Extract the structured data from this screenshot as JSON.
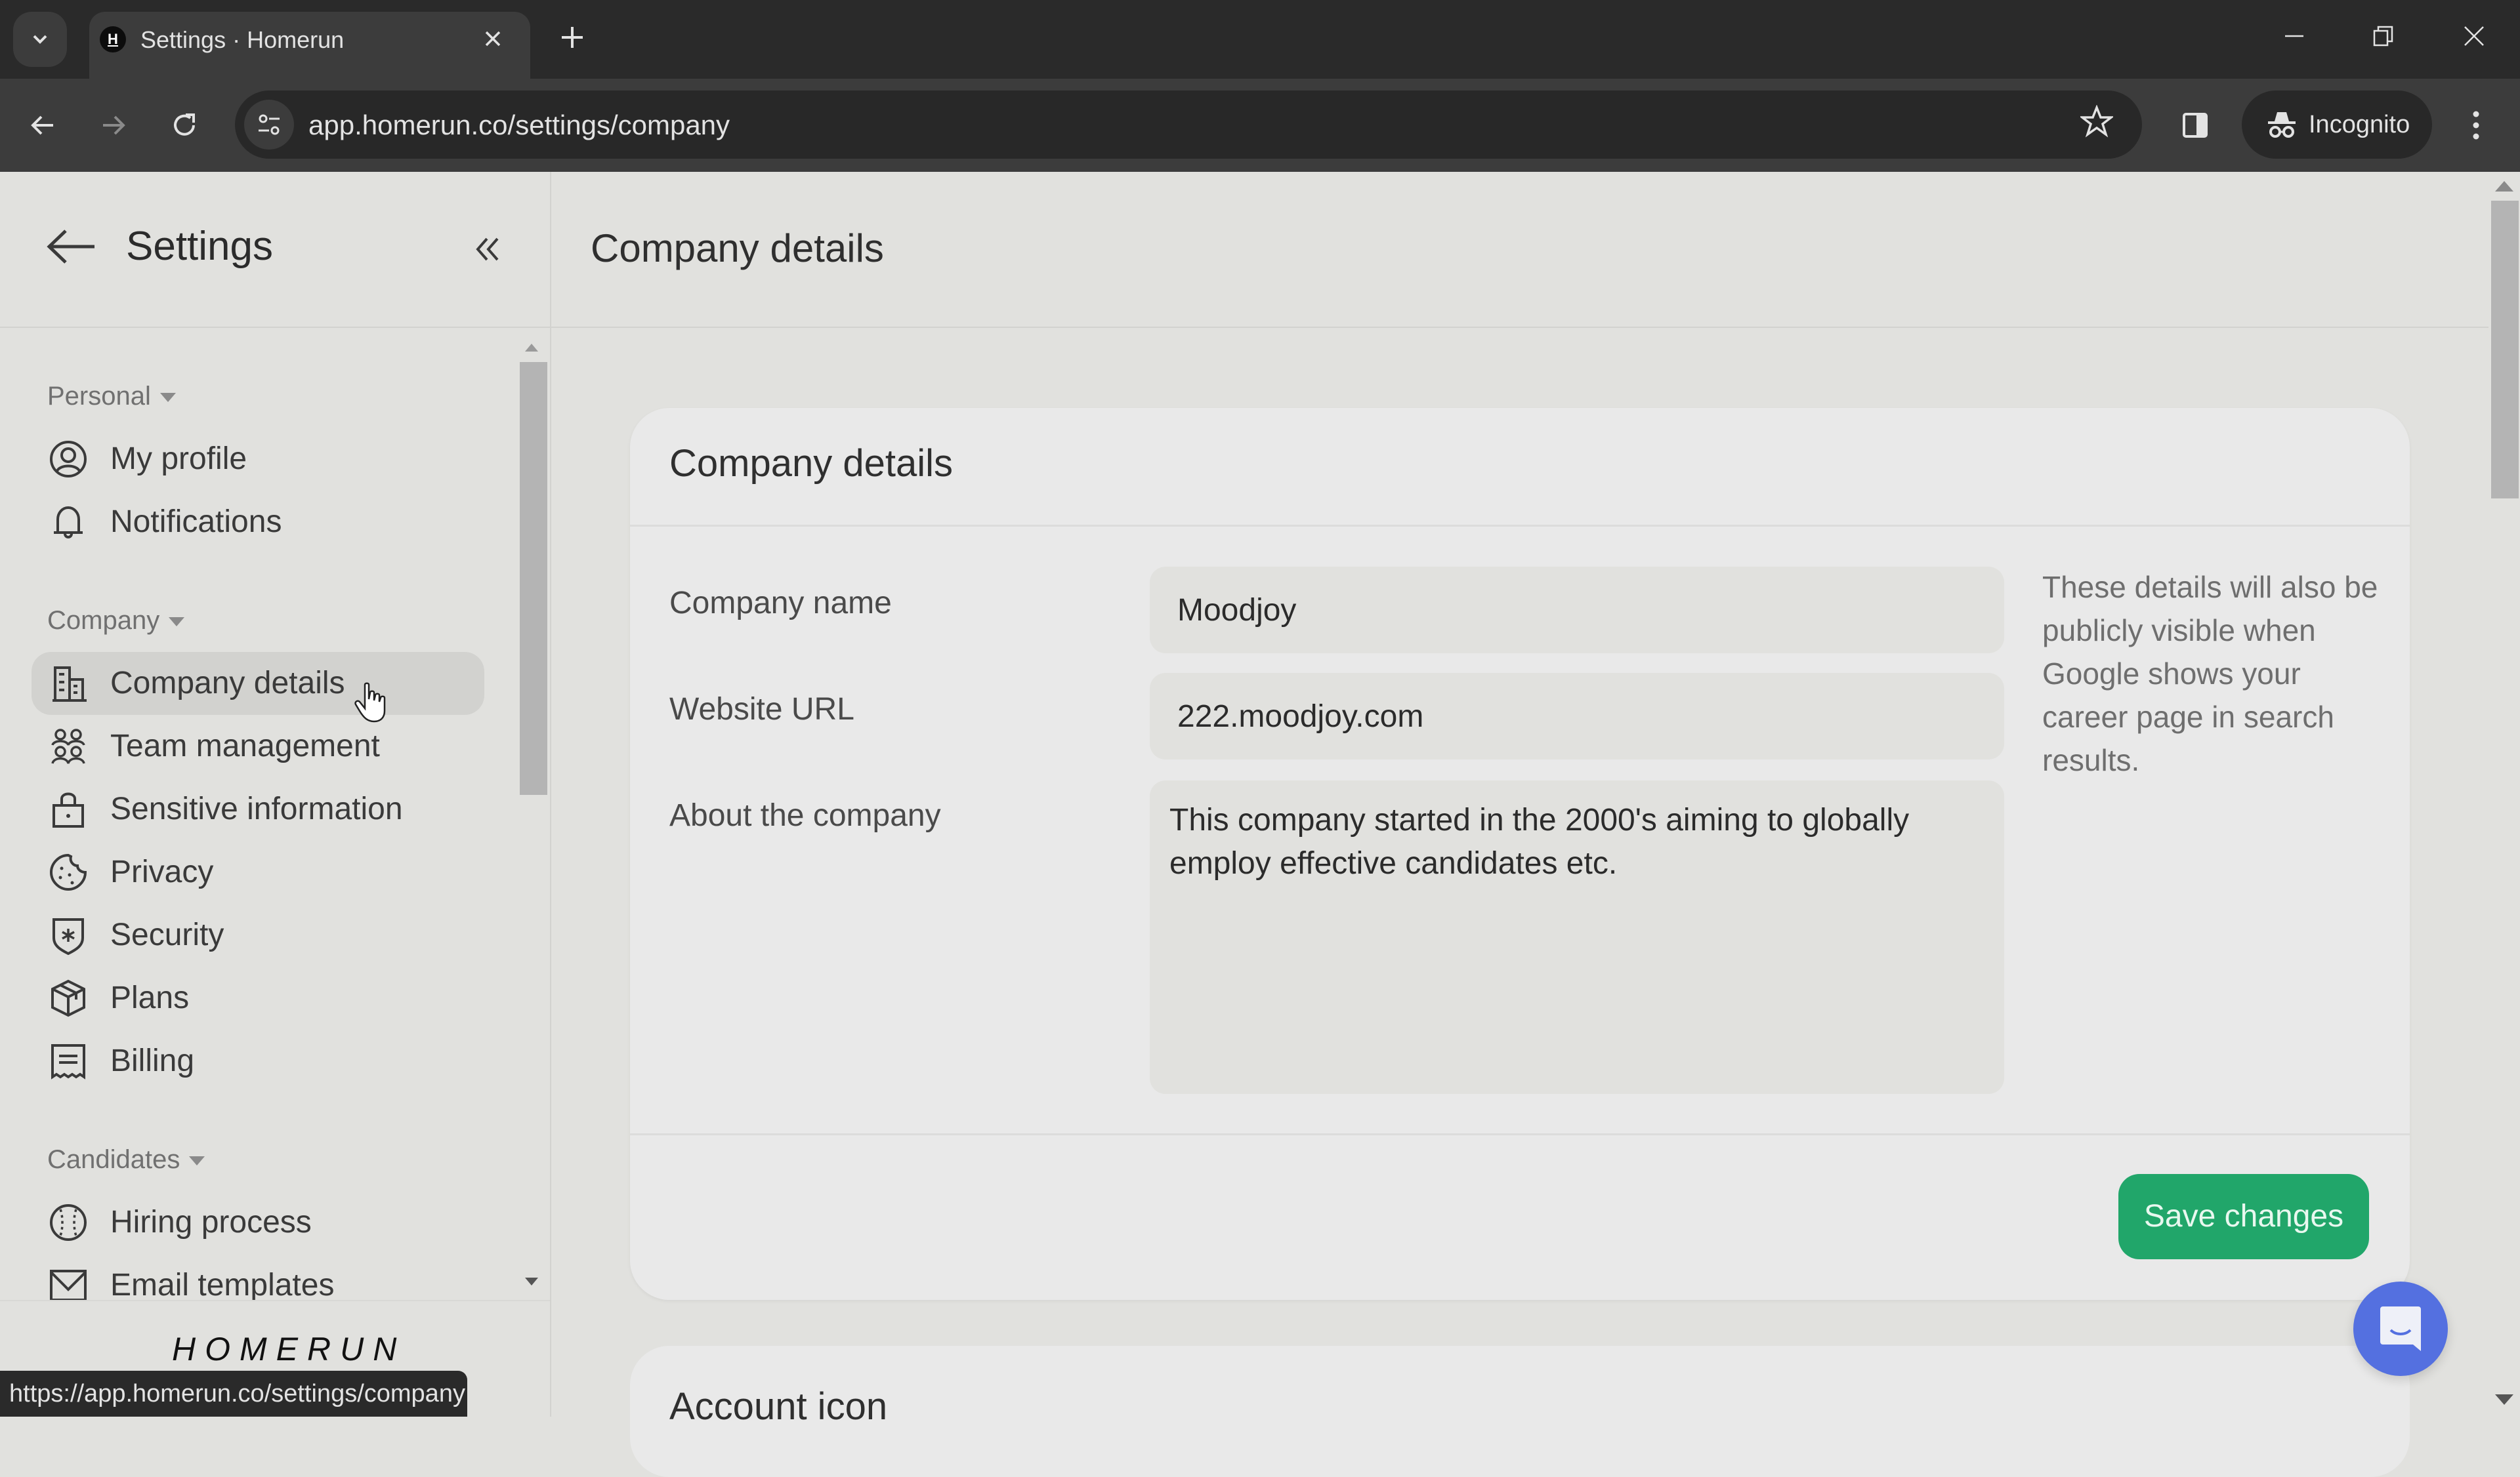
{
  "browser": {
    "tab_title": "Settings · Homerun",
    "tab_favicon_letter": "H",
    "url": "app.homerun.co/settings/company",
    "incognito_label": "Incognito",
    "status_url": "https://app.homerun.co/settings/company",
    "icons": {
      "tab_search": "chevron-down-icon",
      "tab_close": "close-icon",
      "new_tab": "plus-icon",
      "minimize": "minimize-icon",
      "restore": "restore-icon",
      "window_close": "close-icon",
      "back": "arrow-left-icon",
      "forward": "arrow-right-icon",
      "reload": "reload-icon",
      "site_info": "tune-icon",
      "bookmark": "star-icon",
      "side_panel": "side-panel-icon",
      "incognito": "incognito-icon",
      "menu": "kebab-menu-icon"
    }
  },
  "sidebar": {
    "title": "Settings",
    "back_icon": "arrow-left-icon",
    "collapse_icon": "double-chevron-left-icon",
    "sections": [
      {
        "label": "Personal",
        "items": [
          {
            "label": "My profile",
            "icon": "user-circle-icon"
          },
          {
            "label": "Notifications",
            "icon": "bell-icon"
          }
        ]
      },
      {
        "label": "Company",
        "items": [
          {
            "label": "Company details",
            "icon": "building-icon",
            "active": true
          },
          {
            "label": "Team management",
            "icon": "team-icon"
          },
          {
            "label": "Sensitive information",
            "icon": "lock-icon"
          },
          {
            "label": "Privacy",
            "icon": "cookie-icon"
          },
          {
            "label": "Security",
            "icon": "shield-icon"
          },
          {
            "label": "Plans",
            "icon": "package-icon"
          },
          {
            "label": "Billing",
            "icon": "receipt-icon"
          }
        ]
      },
      {
        "label": "Candidates",
        "items": [
          {
            "label": "Hiring process",
            "icon": "baseball-icon"
          },
          {
            "label": "Email templates",
            "icon": "mail-icon"
          }
        ]
      }
    ],
    "logo": "HOMERUN"
  },
  "main": {
    "page_title": "Company details",
    "card": {
      "title": "Company details",
      "fields": {
        "company_name": {
          "label": "Company name",
          "value": "Moodjoy"
        },
        "website_url": {
          "label": "Website URL",
          "value": "222.moodjoy.com"
        },
        "about": {
          "label": "About the company",
          "value": "This company started in the 2000's aiming to globally employ effective candidates etc."
        }
      },
      "help_text": "These details will also be publicly visible when Google shows your career page in search results.",
      "save_label": "Save changes"
    },
    "next_card_title": "Account icon",
    "chat_icon": "chat-support-icon"
  },
  "colors": {
    "accent_green": "#21a66a",
    "chat_blue": "#5470e0",
    "background": "#e1e1de",
    "card": "#e9e9e9"
  }
}
